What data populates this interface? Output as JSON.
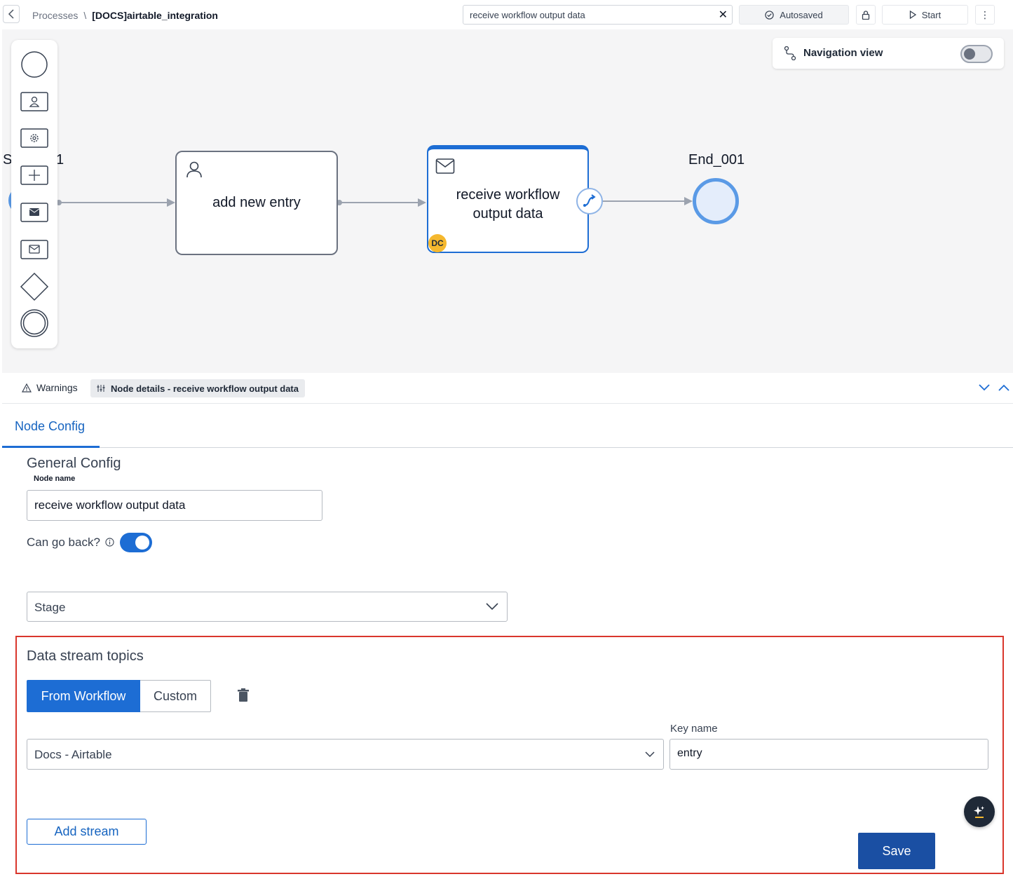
{
  "topbar": {
    "breadcrumb_root": "Processes",
    "breadcrumb_sep": "\\",
    "breadcrumb_current": "[DOCS]airtable_integration",
    "search_value": "receive workflow output data",
    "autosaved_label": "Autosaved",
    "start_label": "Start"
  },
  "canvas": {
    "navigation_view_label": "Navigation view",
    "navigation_view_enabled": false,
    "start_event_label": "St",
    "start_event_suffix": "1",
    "user_task_label": "add new entry",
    "receive_task_label_line1": "receive workflow",
    "receive_task_label_line2": "output data",
    "receive_task_badge": "DC",
    "end_event_label": "End_001",
    "palette": [
      "start-event",
      "user-task",
      "service-task",
      "subprocess",
      "send-message-task",
      "receive-message-task",
      "exclusive-gateway",
      "end-event"
    ]
  },
  "bottom_tabs": {
    "warnings_label": "Warnings",
    "node_details_label": "Node details - receive workflow output data"
  },
  "node_config": {
    "tab_label": "Node Config",
    "general_config_title": "General Config",
    "node_name_label": "Node name",
    "node_name_value": "receive workflow output data",
    "can_go_back_label": "Can go back?",
    "can_go_back_enabled": true,
    "stage_placeholder": "Stage",
    "data_stream": {
      "title": "Data stream topics",
      "from_workflow_label": "From Workflow",
      "custom_label": "Custom",
      "selected_source": "From Workflow",
      "workflow_value": "Docs - Airtable",
      "key_name_label": "Key name",
      "key_name_value": "entry",
      "add_stream_label": "Add stream"
    },
    "save_label": "Save"
  },
  "colors": {
    "accent": "#1d6dd4",
    "save": "#1a4fa3",
    "highlight": "#d9362c",
    "badge": "#f5b82e"
  }
}
